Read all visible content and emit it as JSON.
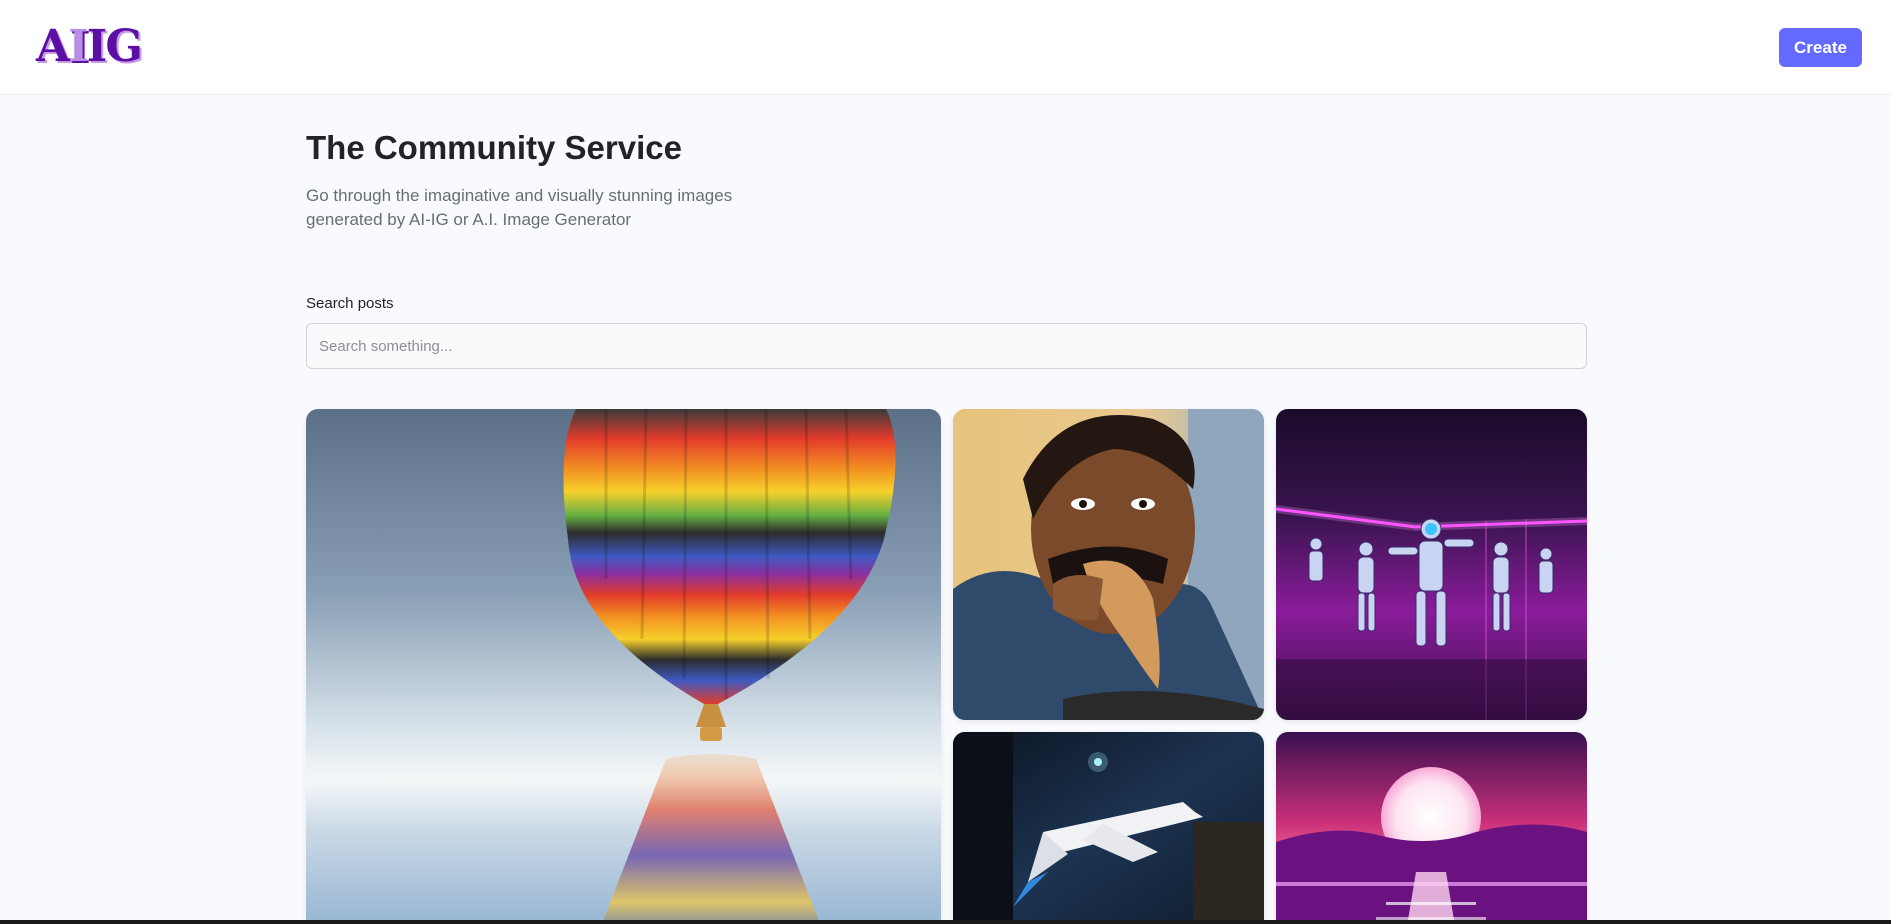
{
  "header": {
    "logo": {
      "part1": "A",
      "part2": "I",
      "part3": "IG"
    },
    "create_label": "Create"
  },
  "intro": {
    "title": "The Community Service",
    "subtitle": "Go through the imaginative and visually stunning images generated by AI-IG or A.I. Image Generator"
  },
  "search": {
    "label": "Search posts",
    "placeholder": "Search something...",
    "value": ""
  },
  "gallery": {
    "posts": [
      {
        "subject": "hot-air-balloon-reflection"
      },
      {
        "subject": "man-eating-flatbread"
      },
      {
        "subject": "dancing-robots-neon-room"
      },
      {
        "subject": "space-shuttle-over-city"
      },
      {
        "subject": "synthwave-sunset"
      }
    ]
  },
  "colors": {
    "accent": "#6469ff",
    "logo_purple": "#5b0fa3",
    "page_background": "#f9fafe"
  }
}
